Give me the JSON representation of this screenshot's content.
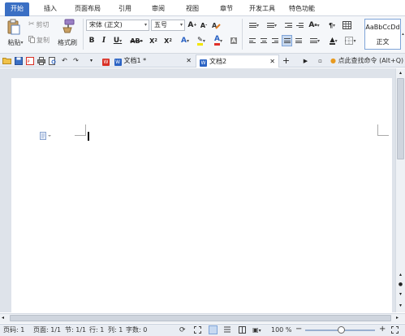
{
  "ribbon_tabs": [
    "开始",
    "插入",
    "页面布局",
    "引用",
    "审阅",
    "视图",
    "章节",
    "开发工具",
    "特色功能"
  ],
  "clipboard": {
    "paste": "粘贴",
    "cut": "剪切",
    "copy": "复制",
    "format_painter": "格式刷"
  },
  "font": {
    "name": "宋体 (正文)",
    "size": "五号"
  },
  "styles": {
    "preview": "AaBbCcDd",
    "normal": "正文"
  },
  "documents": [
    {
      "title": "文档1 *",
      "active": false
    },
    {
      "title": "文档2",
      "active": true
    }
  ],
  "find_command": "点此查找命令 (Alt+Q)",
  "status_bar": {
    "page_number": "页码: 1",
    "pages": "页面: 1/1",
    "section": "节: 1/1",
    "row": "行: 1",
    "column": "列: 1",
    "word_count": "字数: 0",
    "zoom": "100 %"
  },
  "colors": {
    "accent": "#3a6fc4",
    "wps_red": "#d93025",
    "highlight": "#f3e600",
    "font_color": "#e0312a"
  }
}
